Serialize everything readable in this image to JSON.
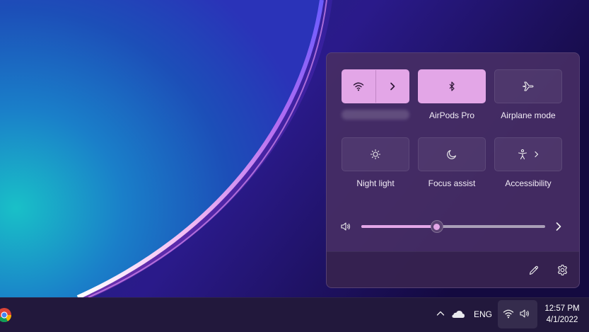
{
  "quick_settings": {
    "tiles": [
      {
        "label": "",
        "icon": "wifi-icon",
        "active": true,
        "has_chevron": true
      },
      {
        "label": "AirPods Pro",
        "icon": "bluetooth-icon",
        "active": true
      },
      {
        "label": "Airplane mode",
        "icon": "airplane-icon",
        "active": false
      },
      {
        "label": "Night light",
        "icon": "brightness-icon",
        "active": false
      },
      {
        "label": "Focus assist",
        "icon": "moon-icon",
        "active": false
      },
      {
        "label": "Accessibility",
        "icon": "accessibility-icon",
        "active": false,
        "has_chevron": true
      }
    ],
    "volume": {
      "icon": "speaker-icon",
      "level": 0.41
    },
    "footer": {
      "edit_icon": "pencil-icon",
      "settings_icon": "gear-icon"
    }
  },
  "taskbar": {
    "pinned": [
      {
        "icon": "chrome-icon"
      }
    ],
    "tray": {
      "overflow_icon": "chevron-up-icon",
      "onedrive_icon": "cloud-icon",
      "language": "ENG",
      "network_icon": "wifi-icon",
      "volume_icon": "speaker-icon",
      "time": "12:57 PM",
      "date": "4/1/2022"
    }
  },
  "colors": {
    "accent": "#e3a6e7",
    "panel": "#462d64",
    "taskbar": "#22183c"
  }
}
